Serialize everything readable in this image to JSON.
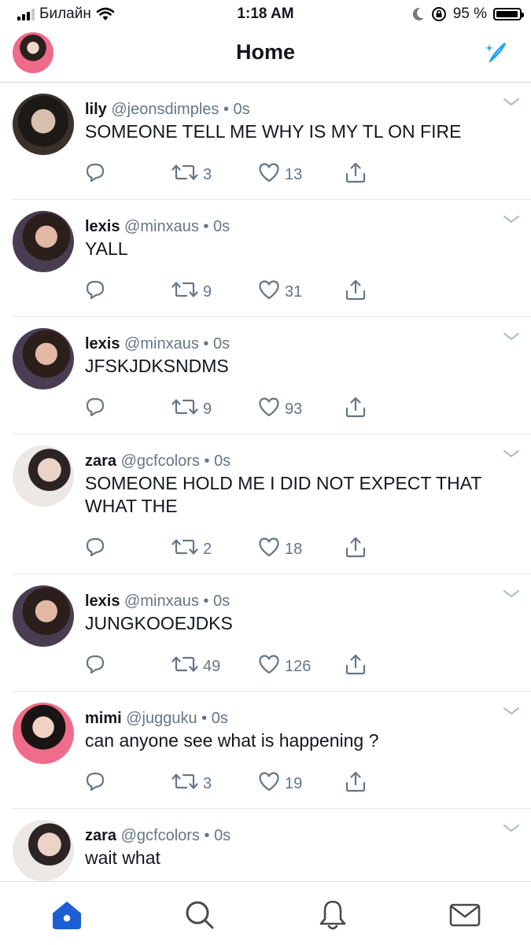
{
  "status_bar": {
    "carrier": "Билайн",
    "time": "1:18 AM",
    "battery": "95 %"
  },
  "header": {
    "title": "Home"
  },
  "tweets": [
    {
      "name": "lily",
      "handle": "@jeonsdimples",
      "time": "0s",
      "text": "SOMEONE TELL ME WHY IS MY TL ON FIRE",
      "retweets": "3",
      "likes": "13",
      "avatar": "lily"
    },
    {
      "name": "lexis",
      "handle": "@minxaus",
      "time": "0s",
      "text": "YALL",
      "retweets": "9",
      "likes": "31",
      "avatar": "lexis"
    },
    {
      "name": "lexis",
      "handle": "@minxaus",
      "time": "0s",
      "text": "JFSKJDKSNDMS",
      "retweets": "9",
      "likes": "93",
      "avatar": "lexis"
    },
    {
      "name": "zara",
      "handle": "@gcfcolors",
      "time": "0s",
      "text": "SOMEONE HOLD ME I DID NOT EXPECT THAT WHAT THE",
      "retweets": "2",
      "likes": "18",
      "avatar": "zara"
    },
    {
      "name": "lexis",
      "handle": "@minxaus",
      "time": "0s",
      "text": "JUNGKOOEJDKS",
      "retweets": "49",
      "likes": "126",
      "avatar": "lexis"
    },
    {
      "name": "mimi",
      "handle": "@jugguku",
      "time": "0s",
      "text": "can anyone see what is happening ?",
      "retweets": "3",
      "likes": "19",
      "avatar": "mimi"
    },
    {
      "name": "zara",
      "handle": "@gcfcolors",
      "time": "0s",
      "text": "wait what",
      "retweets": "",
      "likes": "",
      "avatar": "zara"
    }
  ],
  "colors": {
    "accent": "#1da1f2",
    "home_tab": "#1d5fd3",
    "muted": "#657786"
  },
  "tab_bar": {
    "tabs": [
      "home-icon",
      "search-icon",
      "bell-icon",
      "mail-icon"
    ]
  }
}
